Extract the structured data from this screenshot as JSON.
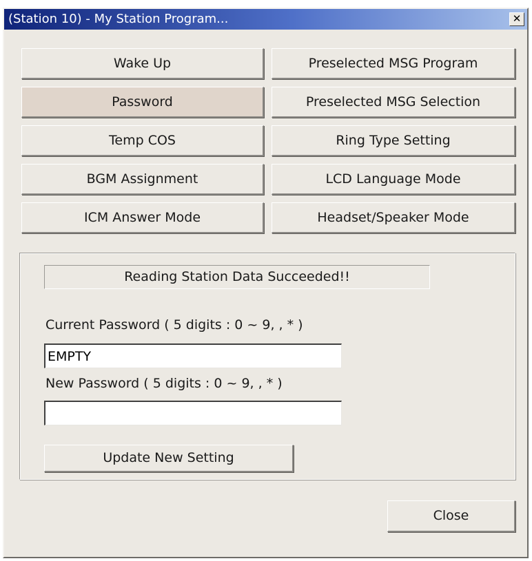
{
  "window": {
    "title": "(Station 10) - My Station Program...",
    "close_glyph": "✕"
  },
  "menu_buttons": [
    {
      "label": "Wake Up"
    },
    {
      "label": "Preselected MSG Program"
    },
    {
      "label": "Password"
    },
    {
      "label": "Preselected MSG Selection"
    },
    {
      "label": "Temp COS"
    },
    {
      "label": "Ring Type Setting"
    },
    {
      "label": "BGM Assignment"
    },
    {
      "label": "LCD Language Mode"
    },
    {
      "label": "ICM Answer Mode"
    },
    {
      "label": "Headset/Speaker Mode"
    }
  ],
  "selected_button": "Password",
  "password_panel": {
    "status_text": "Reading Station Data Succeeded!!",
    "current_label": "Current Password ( 5 digits : 0 ~ 9, , * )",
    "current_value": "EMPTY",
    "new_label": "New Password ( 5 digits : 0 ~ 9, , * )",
    "new_value": "",
    "update_button": "Update New Setting"
  },
  "close_button": "Close"
}
